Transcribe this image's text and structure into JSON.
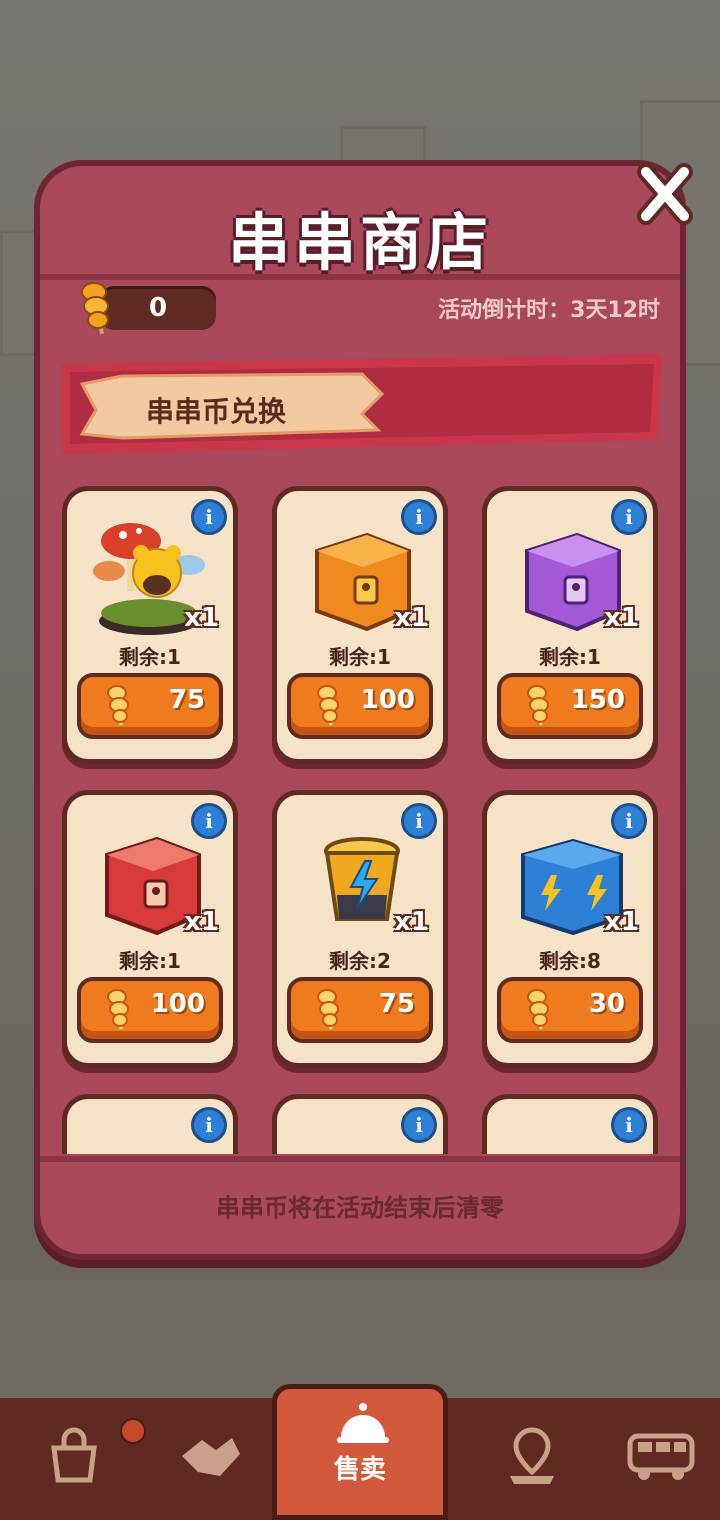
{
  "shop": {
    "title": "串串商店",
    "coin_balance": "0",
    "countdown": "活动倒计时：3天12时",
    "section_label": "串串币兑换",
    "footer_note": "串串币将在活动结束后清零"
  },
  "items": [
    {
      "icon": "mushroom-bear-decoration",
      "qty": "x1",
      "remain": "剩余:1",
      "price": "75"
    },
    {
      "icon": "orange-chest",
      "qty": "x1",
      "remain": "剩余:1",
      "price": "100"
    },
    {
      "icon": "purple-chest",
      "qty": "x1",
      "remain": "剩余:1",
      "price": "150"
    },
    {
      "icon": "red-chest",
      "qty": "x1",
      "remain": "剩余:1",
      "price": "100"
    },
    {
      "icon": "energy-cup",
      "qty": "x1",
      "remain": "剩余:2",
      "price": "75"
    },
    {
      "icon": "blue-energy-box",
      "qty": "x1",
      "remain": "剩余:8",
      "price": "30"
    }
  ],
  "nav": {
    "active_label": "售卖"
  },
  "colors": {
    "panel": "#a8485a",
    "card": "#f6e3c7",
    "button": "#f07b1e",
    "outline": "#5e2a22"
  }
}
